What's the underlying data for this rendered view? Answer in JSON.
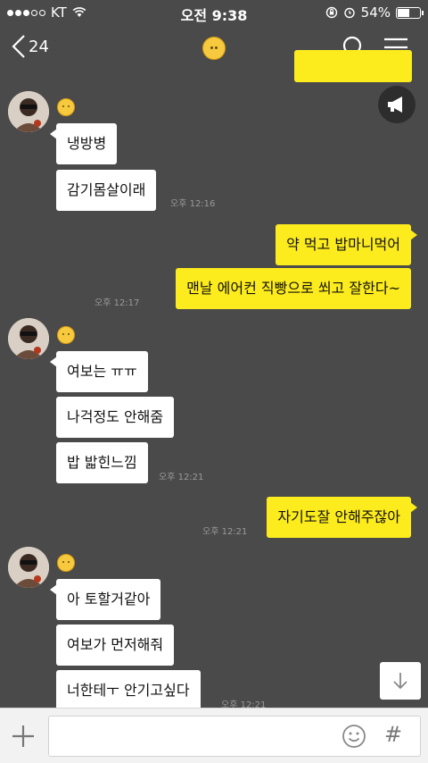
{
  "status": {
    "carrier": "KT",
    "time": "오전 9:38",
    "battery": "54%",
    "battery_level": 0.54
  },
  "header": {
    "back_count": "24",
    "room_icon": "smiley-face-icon"
  },
  "messages": {
    "m1": "냉방병",
    "m2": "감기몸살이래",
    "t1": "오후 12:16",
    "m3": "약 먹고 밥마니먹어",
    "m4": "맨날 에어컨 직빵으로 쐬고  잘한다~",
    "t2": "오후 12:17",
    "m5": "여보는  ㅠㅠ",
    "m6": "나걱정도 안해줌",
    "m7": "밥 밟힌느낌",
    "t3": "오후 12:21",
    "m8": "자기도잘 안해주잖아",
    "t4": "오후 12:21",
    "m9": "아 토할거같아",
    "m10": "여보가 먼저해줘",
    "m11": "너한테ㅜ 안기고싶다",
    "t5": "오후 12:21"
  },
  "input": {
    "value": "",
    "hash_label": "#"
  },
  "colors": {
    "background": "#4a4a4a",
    "my_bubble": "#fceb1d",
    "their_bubble": "#ffffff"
  }
}
